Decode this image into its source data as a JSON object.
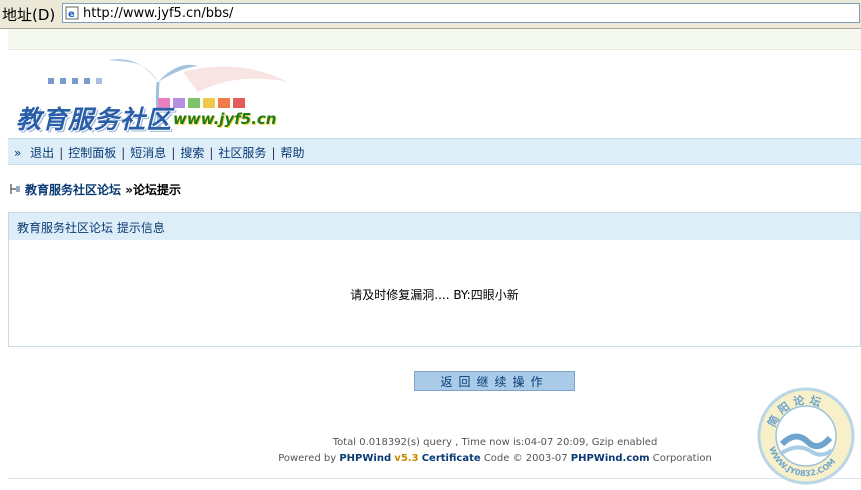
{
  "browser": {
    "address_label": "地址(D)",
    "url": "http://www.jyf5.cn/bbs/"
  },
  "logo": {
    "site_name": "教育服务社区",
    "domain": "www.jyf5.cn"
  },
  "nav": {
    "arrow": "»",
    "items": [
      "退出",
      "控制面板",
      "短消息",
      "搜索",
      "社区服务",
      "帮助"
    ]
  },
  "breadcrumb": {
    "forum_link": "教育服务社区论坛",
    "separator": "»",
    "current": "论坛提示"
  },
  "message": {
    "header": "教育服务社区论坛 提示信息",
    "body": "请及时修复漏洞.... BY:四眼小新"
  },
  "back_button": {
    "label": "返回继续操作"
  },
  "footer": {
    "stats": "Total 0.018392(s) query , Time now is:04-07 20:09, Gzip enabled",
    "powered_prefix": "Powered by",
    "product": "PHPWind",
    "version": "v5.3",
    "certificate": "Certificate",
    "code_text": "Code © 2003-07",
    "company": "PHPWind.com",
    "corporation": "Corporation"
  },
  "watermark": {
    "top_text": "简阳论坛",
    "bottom_text": "WWW.JY0832.COM"
  },
  "colors": {
    "nav_bg": "#deeef8",
    "link": "#0a3a74",
    "button_bg": "#a9cbe8"
  }
}
